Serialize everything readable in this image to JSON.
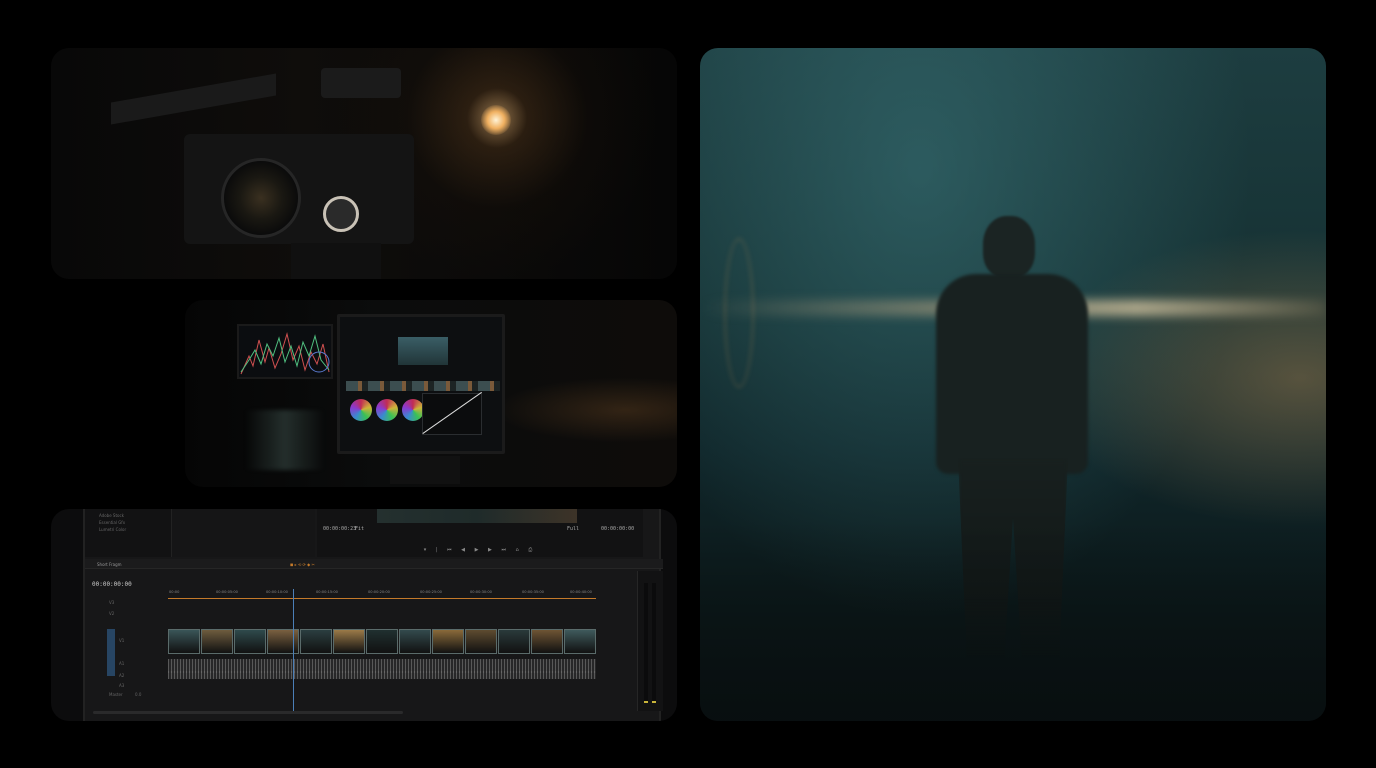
{
  "panels": {
    "camera": {
      "label": "cinema-camera-photo"
    },
    "grading": {
      "label": "color-grading-workstation-photo"
    },
    "hero": {
      "label": "silhouette-in-fog-photo"
    }
  },
  "editor": {
    "program_timecode": "00:00:00:23",
    "fit_label": "Fit",
    "full_label": "Full",
    "duration_timecode": "00:00:00:00",
    "sequence_tab": "Short Fragm",
    "sequence_timecode": "00:00:00:00",
    "ruler_ticks": [
      "00:00",
      "00:00:05:00",
      "00:00:10:00",
      "00:00:15:00",
      "00:00:20:00",
      "00:00:25:00",
      "00:00:30:00",
      "00:00:35:00",
      "00:00:40:00"
    ],
    "sidebar_items": [
      "Adobe Stock",
      "Essential Gfx",
      "Lumetri Color"
    ],
    "track_labels": [
      "V3",
      "V2",
      "V1",
      "A1",
      "A2",
      "A3"
    ],
    "master_label": "Master",
    "master_value": "0.0",
    "meter_scale": [
      "0",
      "-6",
      "-12",
      "-18",
      "-24",
      "-30",
      "-36",
      "-42",
      "-48",
      "-54"
    ]
  },
  "colors": {
    "accent_orange": "#c47a2a",
    "playhead_blue": "#4b7fb8",
    "track_highlight": "#274563",
    "fog_teal": "#1d3d40"
  },
  "clips": [
    "#3a5558",
    "#6e5c3e",
    "#2f4a4c",
    "#7a6040",
    "#2b3e40",
    "#9b7a48",
    "#203030",
    "#334a4d",
    "#8a6a3a",
    "#5e4b30",
    "#2a3a3b",
    "#6e5434",
    "#3f5a5c"
  ]
}
